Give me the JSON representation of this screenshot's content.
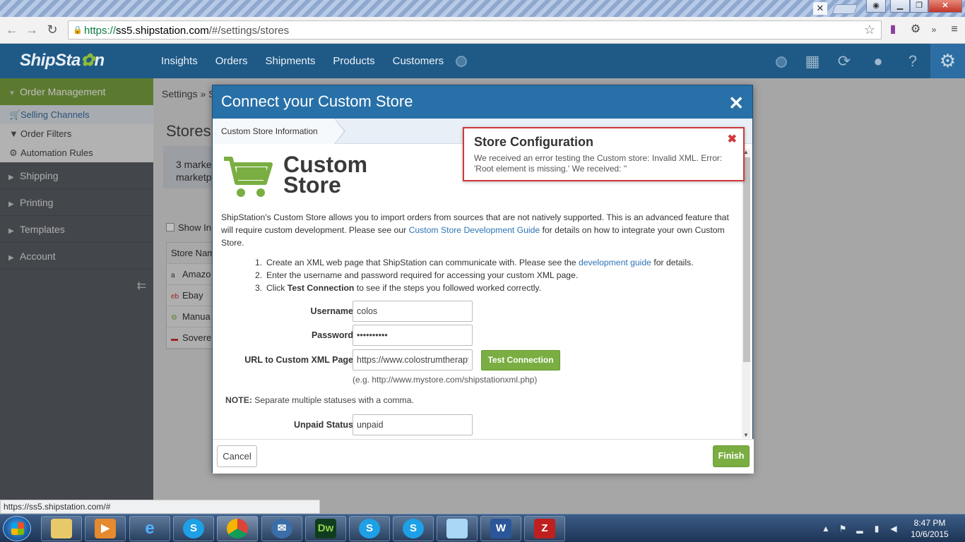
{
  "browser": {
    "url_scheme": "https://",
    "url_host": "ss5.shipstation.com",
    "url_path": "/#/settings/stores",
    "status_url": "https://ss5.shipstation.com/#"
  },
  "app": {
    "logo_text_pre": "ShipSta",
    "logo_text_gear": "✿",
    "logo_text_post": "n",
    "nav": [
      "Insights",
      "Orders",
      "Shipments",
      "Products",
      "Customers"
    ]
  },
  "sidebar": {
    "order_management": "Order Management",
    "sub_items": [
      {
        "label": "Selling Channels",
        "icon": "cart-icon"
      },
      {
        "label": "Order Filters",
        "icon": "filter-icon"
      },
      {
        "label": "Automation Rules",
        "icon": "gears-icon"
      }
    ],
    "items": [
      "Shipping",
      "Printing",
      "Templates",
      "Account"
    ]
  },
  "page": {
    "breadcrumb": "Settings » S",
    "title": "Stores",
    "info_line1": "3 marke",
    "info_line2": "marketp",
    "show_label": "Show In",
    "table_header": "Store Nam",
    "stores": [
      "Amazo",
      "Ebay",
      "Manua",
      "Sovere"
    ]
  },
  "modal": {
    "title": "Connect your Custom Store",
    "wizard_step": "Custom Store Information",
    "logo_line1": "Custom",
    "logo_line2": "Store",
    "intro_part1": "ShipStation's Custom Store allows you to import orders from sources that are not natively supported. This is an advanced feature that will require custom development. Please see our ",
    "intro_link": "Custom Store Development Guide",
    "intro_part2": " for details on how to integrate your own Custom Store.",
    "step1_pre": "Create an XML web page that ShipStation can communicate with. Please see the ",
    "step1_link": "development guide",
    "step1_post": " for details.",
    "step2": "Enter the username and password required for accessing your custom XML page.",
    "step3_pre": "Click ",
    "step3_bold": "Test Connection",
    "step3_post": " to see if the steps you followed worked correctly.",
    "username_label": "Username",
    "username_value": "colos",
    "password_label": "Password",
    "password_value": "••••••••••",
    "url_label": "URL to Custom XML Page",
    "url_value": "https://www.colostrumtherapy",
    "test_button": "Test Connection",
    "url_hint": "(e.g. http://www.mystore.com/shipstationxml.php)",
    "note_label": "NOTE:",
    "note_text": " Separate multiple statuses with a comma.",
    "unpaid_label": "Unpaid Status",
    "unpaid_value": "unpaid",
    "cancel_button": "Cancel",
    "finish_button": "Finish"
  },
  "toast": {
    "title": "Store Configuration",
    "message": "We received an error testing the Custom store: Invalid XML. Error: 'Root element is missing.' We received: ''"
  },
  "taskbar": {
    "time": "8:47 PM",
    "date": "10/6/2015"
  },
  "colors": {
    "primary": "#1f5a87",
    "accent_green": "#7aae42",
    "error_red": "#cf3a3a"
  }
}
